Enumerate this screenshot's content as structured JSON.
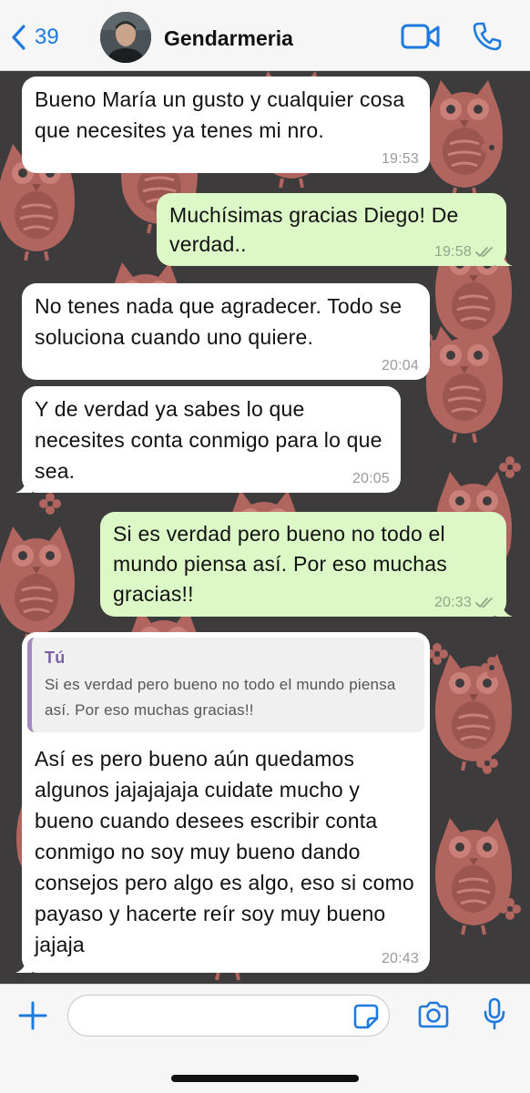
{
  "header": {
    "back_count": "39",
    "contact_name": "Gendarmeria",
    "icons": {
      "back": "chevron-left-icon",
      "video": "video-camera-icon",
      "call": "phone-icon"
    },
    "accent_color": "#1f7ae0"
  },
  "messages": [
    {
      "direction": "incoming",
      "text": "Bueno María un gusto y cualquier cosa que necesites ya tenes mi nro.",
      "time": "19:53"
    },
    {
      "direction": "outgoing",
      "text": "Muchísimas gracias Diego! De verdad..",
      "time": "19:58",
      "status": "read"
    },
    {
      "direction": "incoming",
      "text": "No tenes nada que agradecer. Todo se soluciona cuando uno quiere.",
      "time": "20:04"
    },
    {
      "direction": "incoming",
      "text": "Y de verdad ya sabes lo que necesites conta conmigo para lo que sea.",
      "time": "20:05"
    },
    {
      "direction": "outgoing",
      "text": "Si es verdad pero bueno no todo el mundo piensa así. Por eso muchas gracias!!",
      "time": "20:33",
      "status": "read"
    },
    {
      "direction": "incoming",
      "quote": {
        "author": "Tú",
        "text": "Si es verdad pero bueno no todo el mundo piensa así. Por eso muchas gracias!!"
      },
      "text": "Así es pero bueno aún quedamos algunos jajajajaja cuidate mucho y bueno cuando desees escribir conta conmigo no soy muy bueno dando consejos pero algo es algo, eso si como payaso y hacerte reír soy muy bueno jajaja",
      "time": "20:43"
    }
  ],
  "input_bar": {
    "placeholder": "",
    "icons": {
      "add": "plus-icon",
      "sticker": "sticker-icon",
      "camera": "camera-icon",
      "mic": "microphone-icon"
    }
  },
  "colors": {
    "incoming_bubble": "#ffffff",
    "outgoing_bubble": "#dcf8c6",
    "wallpaper": "#3d3b3b",
    "owl": "#b0655f"
  }
}
